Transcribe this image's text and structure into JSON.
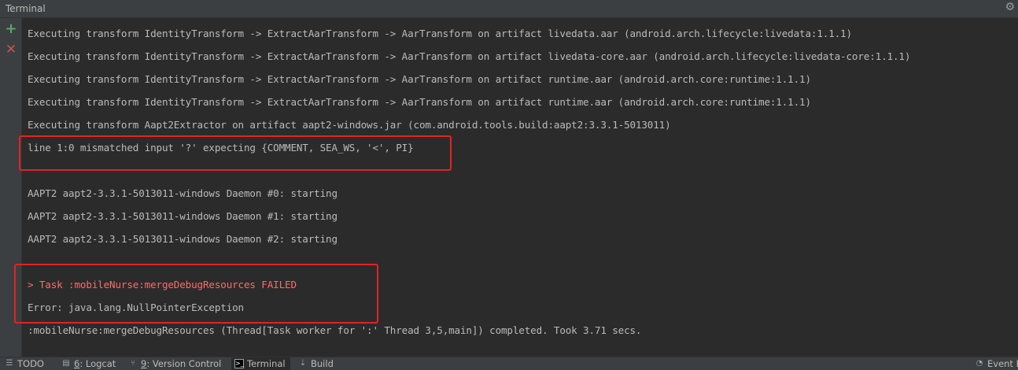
{
  "window": {
    "title": "Terminal"
  },
  "icons": {
    "settings": "gear-icon",
    "new_session": "plus-icon",
    "close_session": "close-icon"
  },
  "colors": {
    "background": "#2b2b2b",
    "panel": "#3c3f41",
    "text": "#bbbbbb",
    "error_text": "#ff6b68",
    "highlight_border": "#e02424",
    "add_green": "#59a869",
    "close_red": "#c75450"
  },
  "console": {
    "lines": [
      "Executing transform IdentityTransform -> ExtractAarTransform -> AarTransform on artifact livedata.aar (android.arch.lifecycle:livedata:1.1.1)",
      "Executing transform IdentityTransform -> ExtractAarTransform -> AarTransform on artifact livedata-core.aar (android.arch.lifecycle:livedata-core:1.1.1)",
      "Executing transform IdentityTransform -> ExtractAarTransform -> AarTransform on artifact runtime.aar (android.arch.core:runtime:1.1.1)",
      "Executing transform IdentityTransform -> ExtractAarTransform -> AarTransform on artifact runtime.aar (android.arch.core:runtime:1.1.1)",
      "Executing transform Aapt2Extractor on artifact aapt2-windows.jar (com.android.tools.build:aapt2:3.3.1-5013011)",
      "line 1:0 mismatched input '?' expecting {COMMENT, SEA_WS, '<', PI}",
      "",
      "AAPT2 aapt2-3.3.1-5013011-windows Daemon #0: starting",
      "AAPT2 aapt2-3.3.1-5013011-windows Daemon #1: starting",
      "AAPT2 aapt2-3.3.1-5013011-windows Daemon #2: starting",
      "",
      "> Task :mobileNurse:mergeDebugResources FAILED",
      "Error: java.lang.NullPointerException",
      ":mobileNurse:mergeDebugResources (Thread[Task worker for ':' Thread 3,5,main]) completed. Took 3.71 secs."
    ]
  },
  "status_bar": {
    "tabs": [
      {
        "mnemonic": "",
        "label": "TODO",
        "icon": "todo-icon"
      },
      {
        "mnemonic": "6",
        "label": ": Logcat",
        "icon": "logcat-icon"
      },
      {
        "mnemonic": "9",
        "label": ": Version Control",
        "icon": "version-control-icon"
      },
      {
        "mnemonic": "",
        "label": "Terminal",
        "icon": "terminal-icon"
      },
      {
        "mnemonic": "",
        "label": "Build",
        "icon": "build-icon"
      }
    ],
    "event_log": {
      "label": "Event L",
      "icon": "event-log-icon"
    }
  }
}
